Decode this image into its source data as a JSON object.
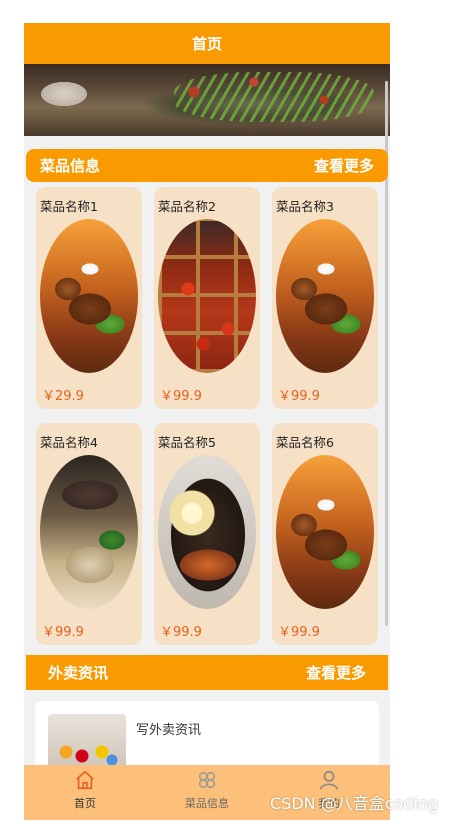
{
  "header": {
    "title": "首页"
  },
  "banner": {
    "dots": 3,
    "active_dot": 0
  },
  "dishes_section": {
    "title": "菜品信息",
    "more": "查看更多"
  },
  "dishes": [
    {
      "name": "菜品名称1",
      "price": "￥29.9",
      "image": "chicken"
    },
    {
      "name": "菜品名称2",
      "price": "￥99.9",
      "image": "hotpot"
    },
    {
      "name": "菜品名称3",
      "price": "￥99.9",
      "image": "chicken"
    },
    {
      "name": "菜品名称4",
      "price": "￥99.9",
      "image": "beef"
    },
    {
      "name": "菜品名称5",
      "price": "￥99.9",
      "image": "bibimbap"
    },
    {
      "name": "菜品名称6",
      "price": "￥99.9",
      "image": "chicken"
    }
  ],
  "news_section": {
    "title": "外卖资讯",
    "more": "查看更多"
  },
  "news": [
    {
      "title": "写外卖资讯"
    }
  ],
  "tabbar": {
    "tabs": [
      {
        "label": "首页",
        "icon": "home-icon",
        "active": true
      },
      {
        "label": "菜品信息",
        "icon": "flower-icon",
        "active": false
      },
      {
        "label": "我的",
        "icon": "user-icon",
        "active": false
      }
    ]
  },
  "watermark": "CSDN @八音盒coding",
  "colors": {
    "accent": "#f99b00",
    "card": "#f6e0c6",
    "price": "#e8611c",
    "tabbar": "#fcc07a"
  }
}
